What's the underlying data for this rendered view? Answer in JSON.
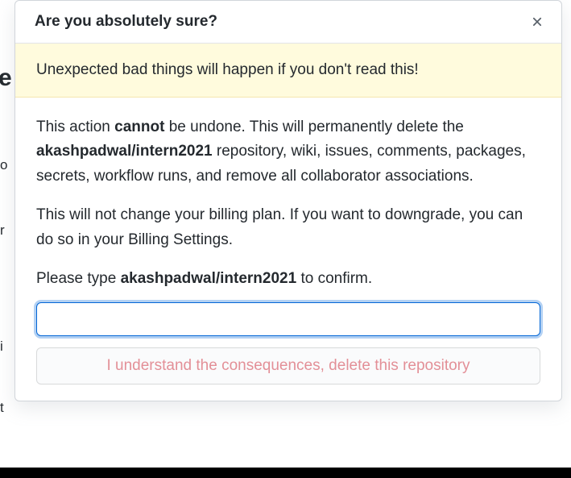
{
  "modal": {
    "title": "Are you absolutely sure?",
    "warning_text": "Unexpected bad things will happen if you don't read this!",
    "body_part1_pre": "This action ",
    "body_part1_strong": "cannot",
    "body_part1_mid": " be undone. This will permanently delete the ",
    "repo_name": "akashpadwal/intern2021",
    "body_part1_post": " repository, wiki, issues, comments, packages, secrets, workflow runs, and remove all collaborator associations.",
    "body_part2": "This will not change your billing plan. If you want to downgrade, you can do so in your Billing Settings.",
    "confirm_prompt_pre": "Please type ",
    "confirm_prompt_post": " to confirm.",
    "input_value": "",
    "delete_button_label": "I understand the consequences, delete this repository"
  }
}
